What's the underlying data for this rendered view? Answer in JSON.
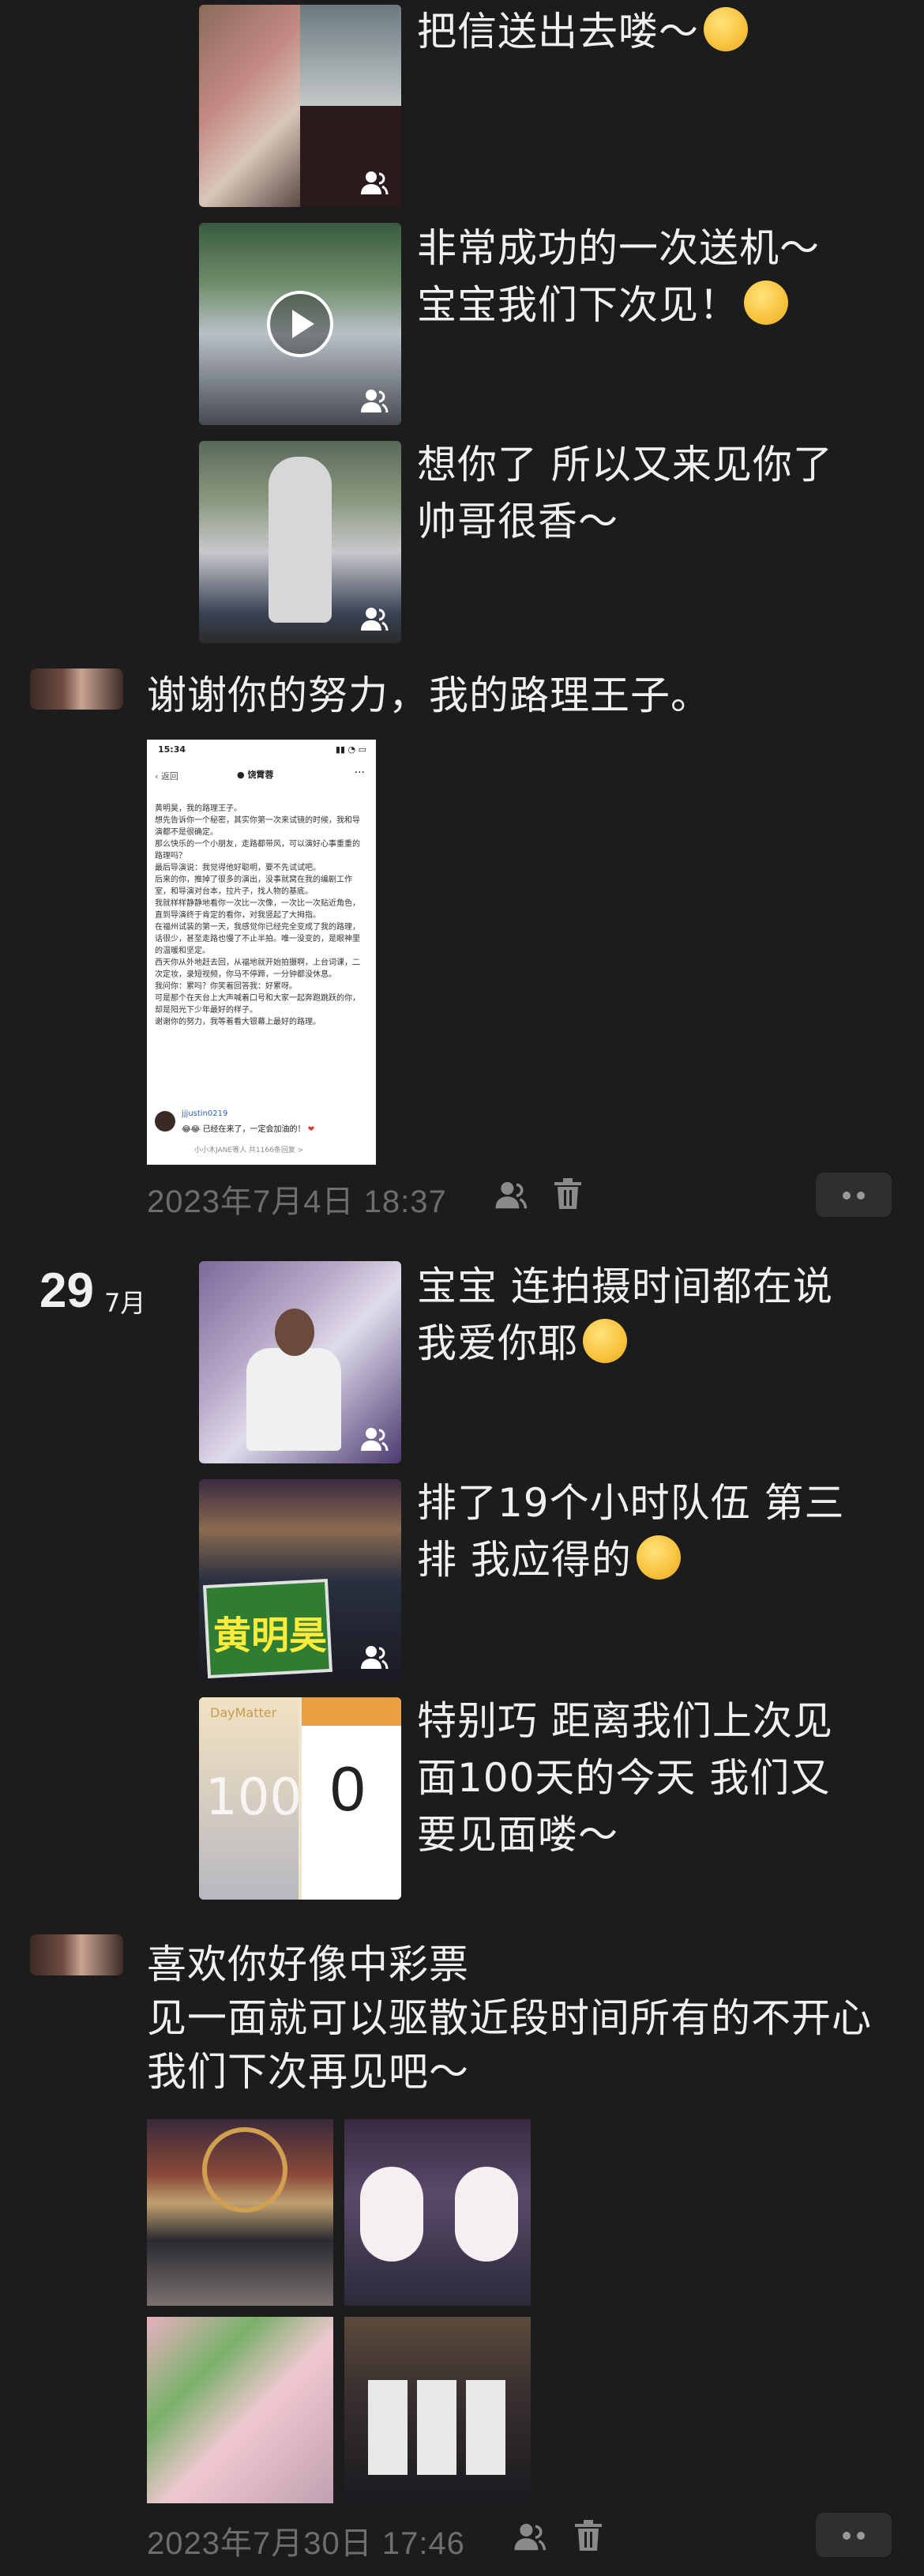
{
  "posts_top": [
    {
      "text_lines": [
        "把信送出去喽～"
      ],
      "emoji": "tongue-face-emoji"
    },
    {
      "text_lines": [
        "非常成功的一次送机～",
        "宝宝我们下次见！"
      ],
      "emoji": "kiss-face-emoji"
    },
    {
      "text_lines": [
        "想你了 所以又来见你了",
        "帅哥很香～"
      ]
    }
  ],
  "moment1": {
    "text": "谢谢你的努力，我的路理王子。",
    "screenshot": {
      "time": "15:34",
      "back": "返回",
      "author": "饶霄蓉",
      "lines": [
        "黄明昊，我的路理王子。",
        "想先告诉你一个秘密，其实你第一次来试镜的时候，我和导演都不是很确定。",
        "那么快乐的一个小朋友，走路都带风，可以演好心事重重的路理吗？",
        "最后导演说：我觉得他好聪明，要不先试试吧。",
        "后来的你，推掉了很多的演出，没事就窝在我的编剧工作室，和导演对台本，拉片子，找人物的基底。",
        "我就样样静静地看你一次比一次像，一次比一次贴近角色，直到导演终于肯定的看你，对我竖起了大拇指。",
        "在福州试装的第一天，我感觉你已经完全变成了我的路理，话很少，甚至走路也慢了不止半拍。唯一没变的，是眼神里的温暖和坚定。",
        "西天你从外地赶去回，从福地就开始拍摄啊，上台词课，二次定妆，录短视频，你马不停蹄，一分钟都没休息。",
        "我问你：累吗？你笑着回答我：好累呀。",
        "可是那个在天台上大声喊着口号和大家一起奔跑跳跃的你，却是阳光下少年最好的样子。",
        "谢谢你的努力，我等着看大银幕上最好的路理。"
      ],
      "commenter": "jjjustin0219",
      "comment": "已经在来了，一定会加油的！",
      "footer": "小小木JANE等人 共1166条回复 >"
    },
    "timestamp": "2023年7月4日 18:37"
  },
  "date_header": {
    "day": "29",
    "month": "7月"
  },
  "posts_mid": [
    {
      "text_lines": [
        "宝宝 连拍摄时间都在说",
        "我爱你耶"
      ],
      "emoji": "kiss-face-emoji"
    },
    {
      "text_lines": [
        "排了19个小时队伍 第三",
        "排 我应得的"
      ],
      "emoji": "smirk-face-emoji"
    },
    {
      "text_lines": [
        "特别巧 距离我们上次见",
        "面100天的今天 我们又",
        "要见面喽～"
      ]
    }
  ],
  "daymatter": {
    "title": "DayMatter",
    "counter": "0",
    "countup": "100"
  },
  "banner_text": "黄明昊",
  "moment2": {
    "text_lines": [
      "喜欢你好像中彩票",
      "见一面就可以驱散近段时间所有的不开心",
      "我们下次再见吧～"
    ],
    "timestamp": "2023年7月30日 17:46"
  },
  "colors": {
    "background": "#1c1c1c",
    "text": "#f0f0f0",
    "meta": "#6e6e6e",
    "button": "#2f2f2f"
  }
}
